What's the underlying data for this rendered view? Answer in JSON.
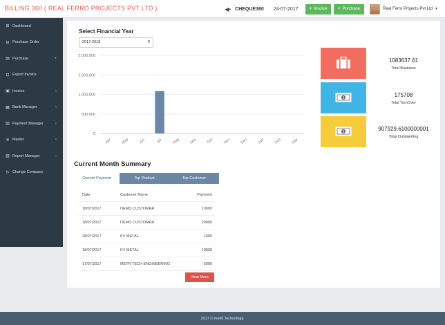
{
  "header": {
    "title": "BILLING 360 ( REAL FERRO PROJECTS PVT LTD )",
    "cheque_label": "CHEQUE360",
    "date": "24-07-2017",
    "invoice_button": "Invoice",
    "purchase_button": "Purchase",
    "user_name": "Real Ferro Projects Pvt Ltd"
  },
  "sidebar": {
    "items": [
      {
        "label": "Dashboard",
        "icon": "dashboard-icon",
        "glyph": "⊞",
        "chevron": ""
      },
      {
        "label": "Purchase Order",
        "icon": "cart-icon",
        "glyph": "⊟",
        "chevron": ""
      },
      {
        "label": "Purchase",
        "icon": "bag-icon",
        "glyph": "▤",
        "chevron": "+"
      },
      {
        "label": "Export Invoice",
        "icon": "export-icon",
        "glyph": "⊡",
        "chevron": ""
      },
      {
        "label": "Invoice",
        "icon": "invoice-icon",
        "glyph": "▣",
        "chevron": "‹"
      },
      {
        "label": "Bank Manager",
        "icon": "bank-icon",
        "glyph": "▦",
        "chevron": "‹"
      },
      {
        "label": "Payment Manager",
        "icon": "payment-icon",
        "glyph": "▥",
        "chevron": "‹"
      },
      {
        "label": "Master",
        "icon": "gear-icon",
        "glyph": "✲",
        "chevron": "‹"
      },
      {
        "label": "Report Manager",
        "icon": "report-icon",
        "glyph": "▧",
        "chevron": "‹"
      },
      {
        "label": "Change Company",
        "icon": "refresh-icon",
        "glyph": "↻",
        "chevron": ""
      }
    ]
  },
  "financial_year": {
    "title": "Select Financial Year",
    "selected": "2017-2018"
  },
  "chart_data": {
    "type": "bar",
    "categories": [
      "Apr",
      "May",
      "Jun",
      "Jul",
      "Aug",
      "Sep",
      "Oct",
      "Nov",
      "Dec",
      "Jan",
      "Feb",
      "Mar"
    ],
    "values": [
      0,
      0,
      0,
      1083637.61,
      0,
      0,
      0,
      0,
      0,
      0,
      0,
      0
    ],
    "title": "",
    "xlabel": "",
    "ylabel": "",
    "ylim": [
      0,
      2000000
    ],
    "yticks": [
      "2,000,000",
      "1,500,000",
      "1,000,000",
      "500,000",
      "0"
    ],
    "ytick_values": [
      2000000,
      1500000,
      1000000,
      500000,
      0
    ],
    "bar_color": "#6b87a6",
    "grid": true
  },
  "stats": [
    {
      "value": "1083637.61",
      "label": "Total Business",
      "color": "#f26c5f",
      "icon": "briefcase-icon"
    },
    {
      "value": "175708",
      "label": "Total TurnOver",
      "color": "#3fb5e5",
      "icon": "money-icon"
    },
    {
      "value": "907929.6100000001",
      "label": "Total Outstanding",
      "color": "#f5cc3c",
      "icon": "money-icon"
    }
  ],
  "summary": {
    "title": "Current Month Summary",
    "tabs": [
      "Current Payment",
      "Top Product",
      "Top Customer"
    ],
    "columns": [
      "Date",
      "Customer Name",
      "Payment"
    ],
    "rows": [
      {
        "date": "18/07/2017",
        "name": "DEMO CUSTOMER",
        "amount": "10000"
      },
      {
        "date": "18/07/2017",
        "name": "DEMO CUSTOMER",
        "amount": "20000"
      },
      {
        "date": "28/07/2017",
        "name": "KV METAL",
        "amount": "1000"
      },
      {
        "date": "18/07/2017",
        "name": "KV METAL",
        "amount": "10000"
      },
      {
        "date": "17/07/2017",
        "name": "METR TECH ENGINEERING",
        "amount": "5000"
      }
    ],
    "view_more": "View More"
  },
  "footer": {
    "text": "2017 © metR Technology."
  }
}
